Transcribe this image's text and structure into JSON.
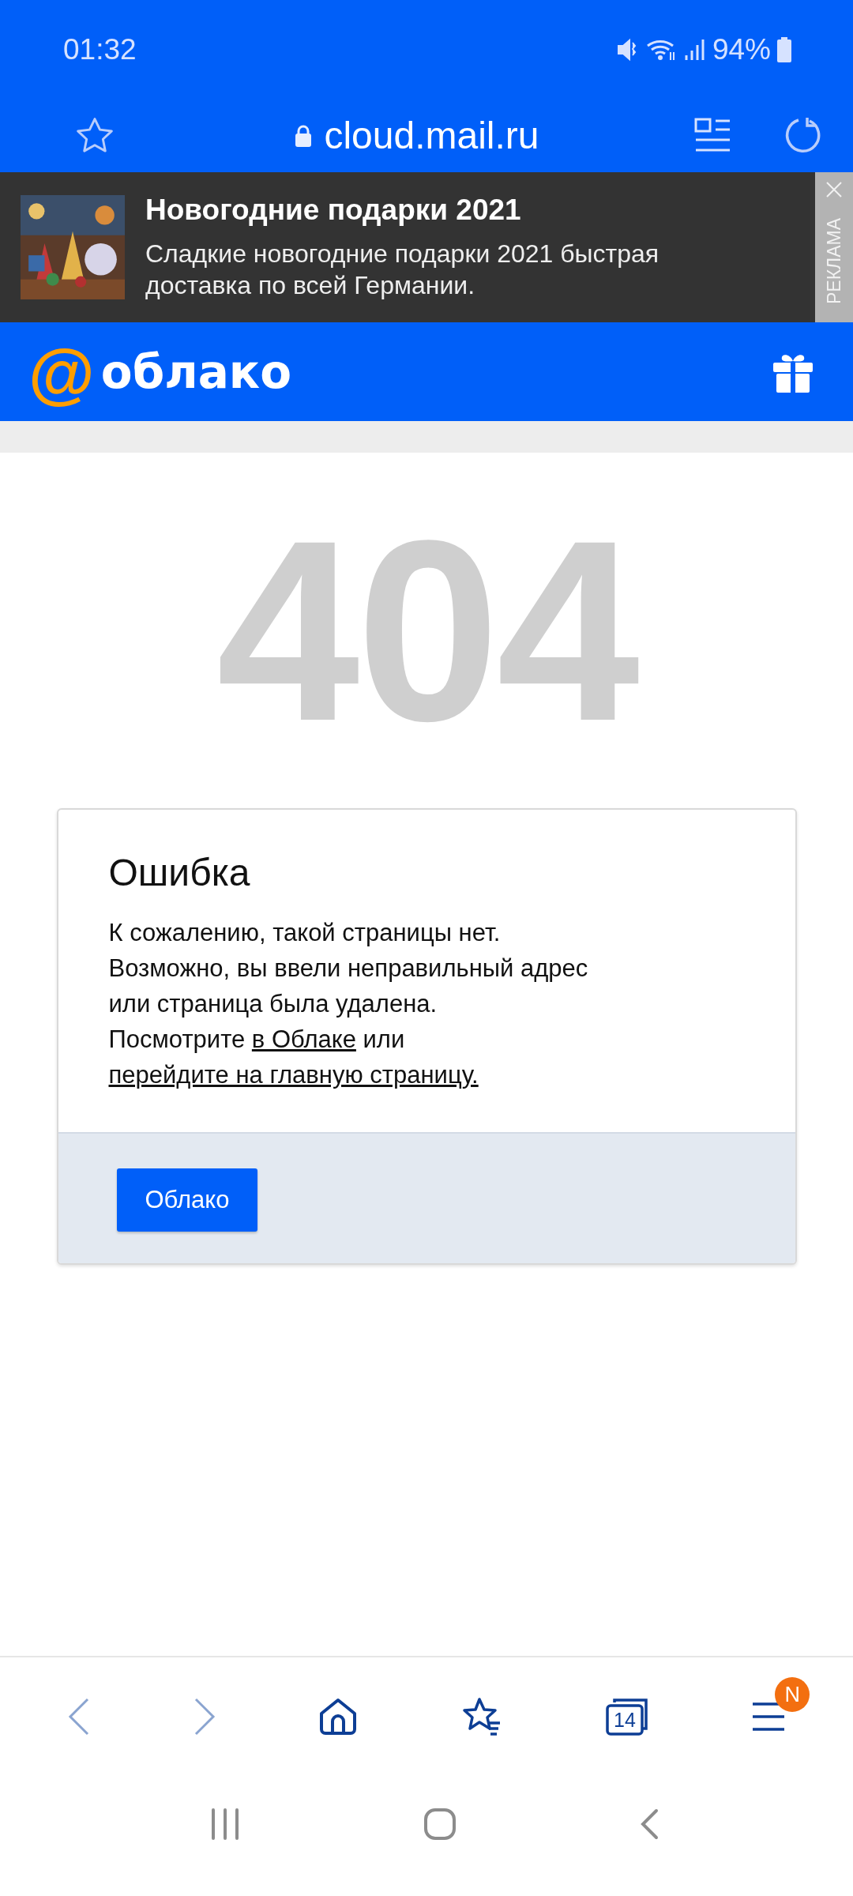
{
  "status_bar": {
    "time": "01:32",
    "battery": "94%"
  },
  "address_bar": {
    "url": "cloud.mail.ru"
  },
  "ad": {
    "title": "Новогодние подарки 2021",
    "text": "Сладкие новогодние подарки 2021 быстрая доставка по всей Германии.",
    "label": "РЕКЛАМА"
  },
  "header": {
    "logo_mark": "@",
    "logo_text": "облако"
  },
  "error": {
    "code": "404",
    "title": "Ошибка",
    "lines": [
      "К сожалению, такой страницы нет.",
      "Возможно, вы ввели неправильный адрес",
      "или страница была удалена."
    ],
    "prompt": "Посмотрите",
    "joiner": "или",
    "links": [
      {
        "text": "в Облаке"
      },
      {
        "text": "перейдите на главную страницу."
      }
    ],
    "button": "Облако"
  },
  "bottom_nav": {
    "tab_count": "14",
    "menu_badge": "N"
  }
}
